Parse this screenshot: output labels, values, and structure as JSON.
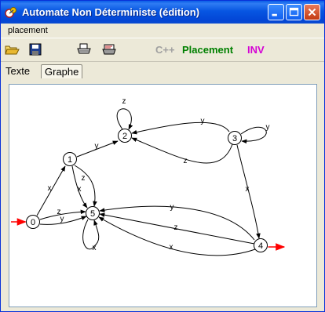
{
  "window": {
    "title": "Automate Non Déterministe (édition)"
  },
  "menu": {
    "items": [
      "placement"
    ]
  },
  "toolbar": {
    "icons": [
      "open-folder-icon",
      "save-disk-icon",
      "print-icon",
      "printer-preview-icon"
    ],
    "cpp_label": "C++",
    "placement_label": "Placement",
    "inv_label": "INV",
    "colors": {
      "cpp": "#a0a0a0",
      "placement": "#008000",
      "inv": "#d400d4"
    }
  },
  "tabs": [
    {
      "label": "Texte",
      "active": false
    },
    {
      "label": "Graphe",
      "active": true
    }
  ],
  "graph": {
    "states": [
      {
        "id": "0",
        "label": "0",
        "initial": true,
        "final": false
      },
      {
        "id": "1",
        "label": "1",
        "initial": false,
        "final": false
      },
      {
        "id": "2",
        "label": "2",
        "initial": false,
        "final": false
      },
      {
        "id": "3",
        "label": "3",
        "initial": false,
        "final": false
      },
      {
        "id": "4",
        "label": "4",
        "initial": false,
        "final": true
      },
      {
        "id": "5",
        "label": "5",
        "initial": false,
        "final": false
      }
    ],
    "transitions": [
      {
        "from": "2",
        "to": "2",
        "label": "z"
      },
      {
        "from": "3",
        "to": "3",
        "label": "y"
      },
      {
        "from": "3",
        "to": "2",
        "label": "y"
      },
      {
        "from": "3",
        "to": "2",
        "label": "z"
      },
      {
        "from": "1",
        "to": "2",
        "label": "y"
      },
      {
        "from": "0",
        "to": "1",
        "label": "x"
      },
      {
        "from": "1",
        "to": "5",
        "label": "z"
      },
      {
        "from": "1",
        "to": "5",
        "label": "x"
      },
      {
        "from": "0",
        "to": "5",
        "label": "z"
      },
      {
        "from": "0",
        "to": "5",
        "label": "y"
      },
      {
        "from": "5",
        "to": "5",
        "label": "x"
      },
      {
        "from": "3",
        "to": "4",
        "label": "x"
      },
      {
        "from": "4",
        "to": "5",
        "label": "y"
      },
      {
        "from": "4",
        "to": "5",
        "label": "z"
      },
      {
        "from": "4",
        "to": "5",
        "label": "x"
      }
    ]
  }
}
